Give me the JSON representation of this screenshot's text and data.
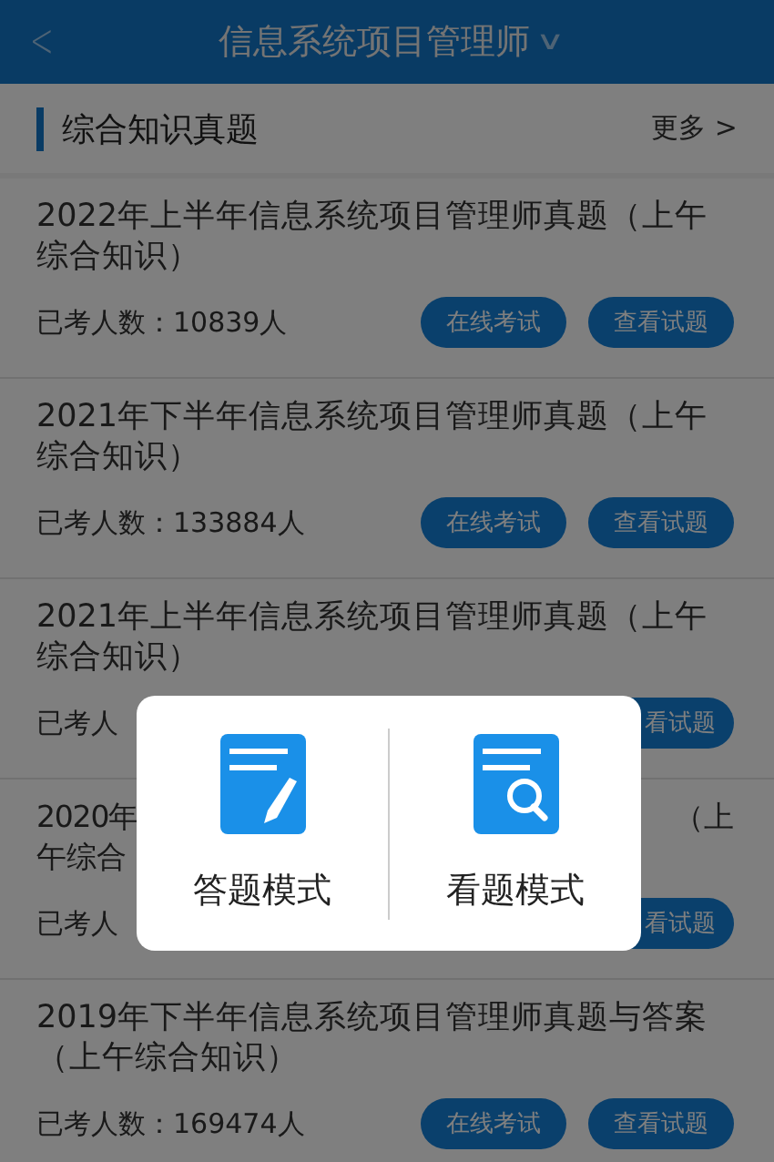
{
  "header": {
    "back": "<",
    "title": "信息系统项目管理师",
    "caret": "∨"
  },
  "section": {
    "title": "综合知识真题",
    "more": "更多 >"
  },
  "items": [
    {
      "kind": "full",
      "title": "2022年上半年信息系统项目管理师真题（上午综合知识）",
      "count": "已考人数：10839人",
      "buttons": [
        "在线考试",
        "查看试题"
      ]
    },
    {
      "kind": "full",
      "title": "2021年下半年信息系统项目管理师真题（上午综合知识）",
      "count": "已考人数：133884人",
      "buttons": [
        "在线考试",
        "查看试题"
      ]
    },
    {
      "kind": "partial",
      "title": "2021年上半年信息系统项目管理师真题（上午综合知识）",
      "count": "已考人",
      "buttons": [
        "看试题"
      ]
    },
    {
      "kind": "partial",
      "title_fragments": [
        {
          "left": "2020年",
          "right": "（上"
        },
        {
          "left": "午综合"
        }
      ],
      "count": "已考人",
      "buttons": [
        "看试题"
      ]
    },
    {
      "kind": "full",
      "title": "2019年下半年信息系统项目管理师真题与答案（上午综合知识）",
      "count": "已考人数：169474人",
      "buttons": [
        "在线考试",
        "查看试题"
      ]
    }
  ],
  "dialog": {
    "options": [
      {
        "kind": "answer",
        "label": "答题模式"
      },
      {
        "kind": "view",
        "label": "看题模式"
      }
    ]
  }
}
